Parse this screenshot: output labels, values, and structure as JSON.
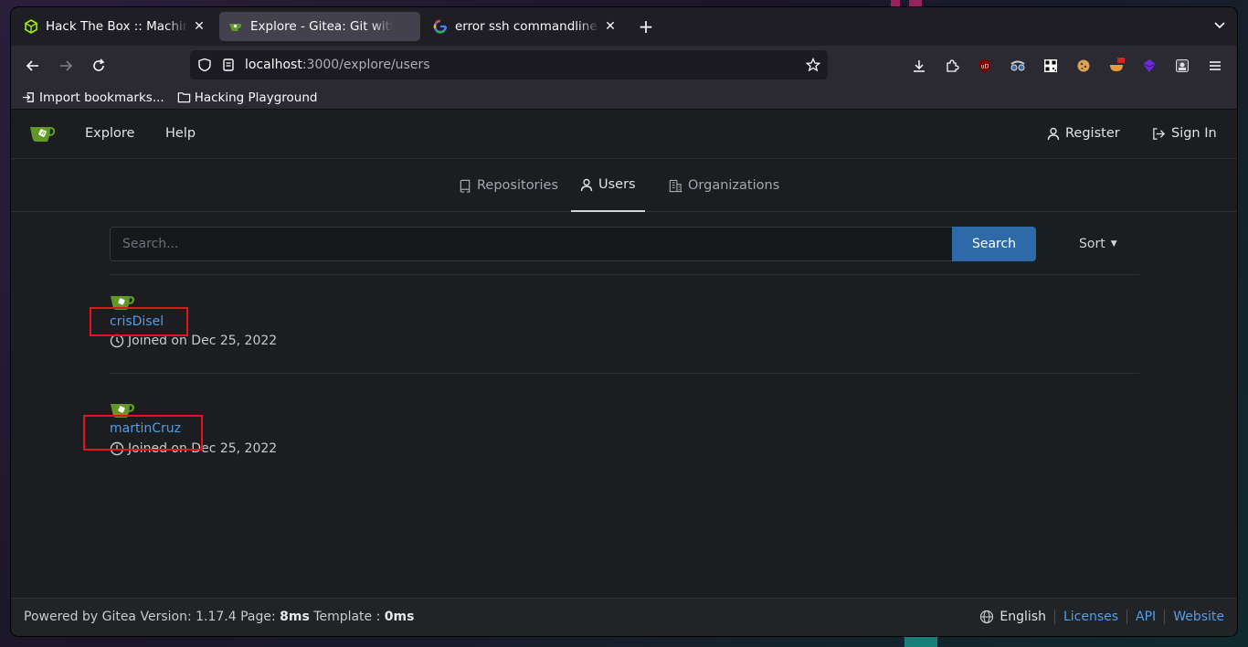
{
  "browser": {
    "tabs": [
      {
        "title": "Hack The Box :: Machines",
        "icon": "htb-cube-icon",
        "active": false
      },
      {
        "title": "Explore - Gitea: Git with a cup of tea",
        "icon": "gitea-favicon",
        "active": true
      },
      {
        "title": "error ssh commandline d",
        "icon": "google-g-icon",
        "active": false
      }
    ],
    "url_host": "localhost",
    "url_path": ":3000/explore/users",
    "bookmarks": [
      {
        "label": "Import bookmarks...",
        "icon": "import-icon"
      },
      {
        "label": "Hacking Playground",
        "icon": "folder-icon"
      }
    ]
  },
  "gitea": {
    "nav": {
      "explore": "Explore",
      "help": "Help",
      "register": "Register",
      "sign_in": "Sign In"
    },
    "explore_tabs": [
      {
        "label": "Repositories",
        "icon": "repo-icon",
        "active": false
      },
      {
        "label": "Users",
        "icon": "person-icon",
        "active": true
      },
      {
        "label": "Organizations",
        "icon": "organization-icon",
        "active": false
      }
    ],
    "search": {
      "placeholder": "Search...",
      "button": "Search",
      "sort": "Sort"
    },
    "users": [
      {
        "name": "crisDisel",
        "joined": "Joined on Dec 25, 2022",
        "highlighted": true
      },
      {
        "name": "martinCruz",
        "joined": "Joined on Dec 25, 2022",
        "highlighted": true
      }
    ],
    "footer": {
      "powered_prefix": "Powered by Gitea Version: 1.17.4 Page: ",
      "page_time": "8ms",
      "template_label": " Template : ",
      "template_time": "0ms",
      "language": "English",
      "licenses": "Licenses",
      "api": "API",
      "website": "Website"
    }
  },
  "colors": {
    "link": "#4f9ee8",
    "search_button": "#2f6aa8",
    "highlight_box": "#e0161a",
    "gitea_green": "#609926"
  }
}
